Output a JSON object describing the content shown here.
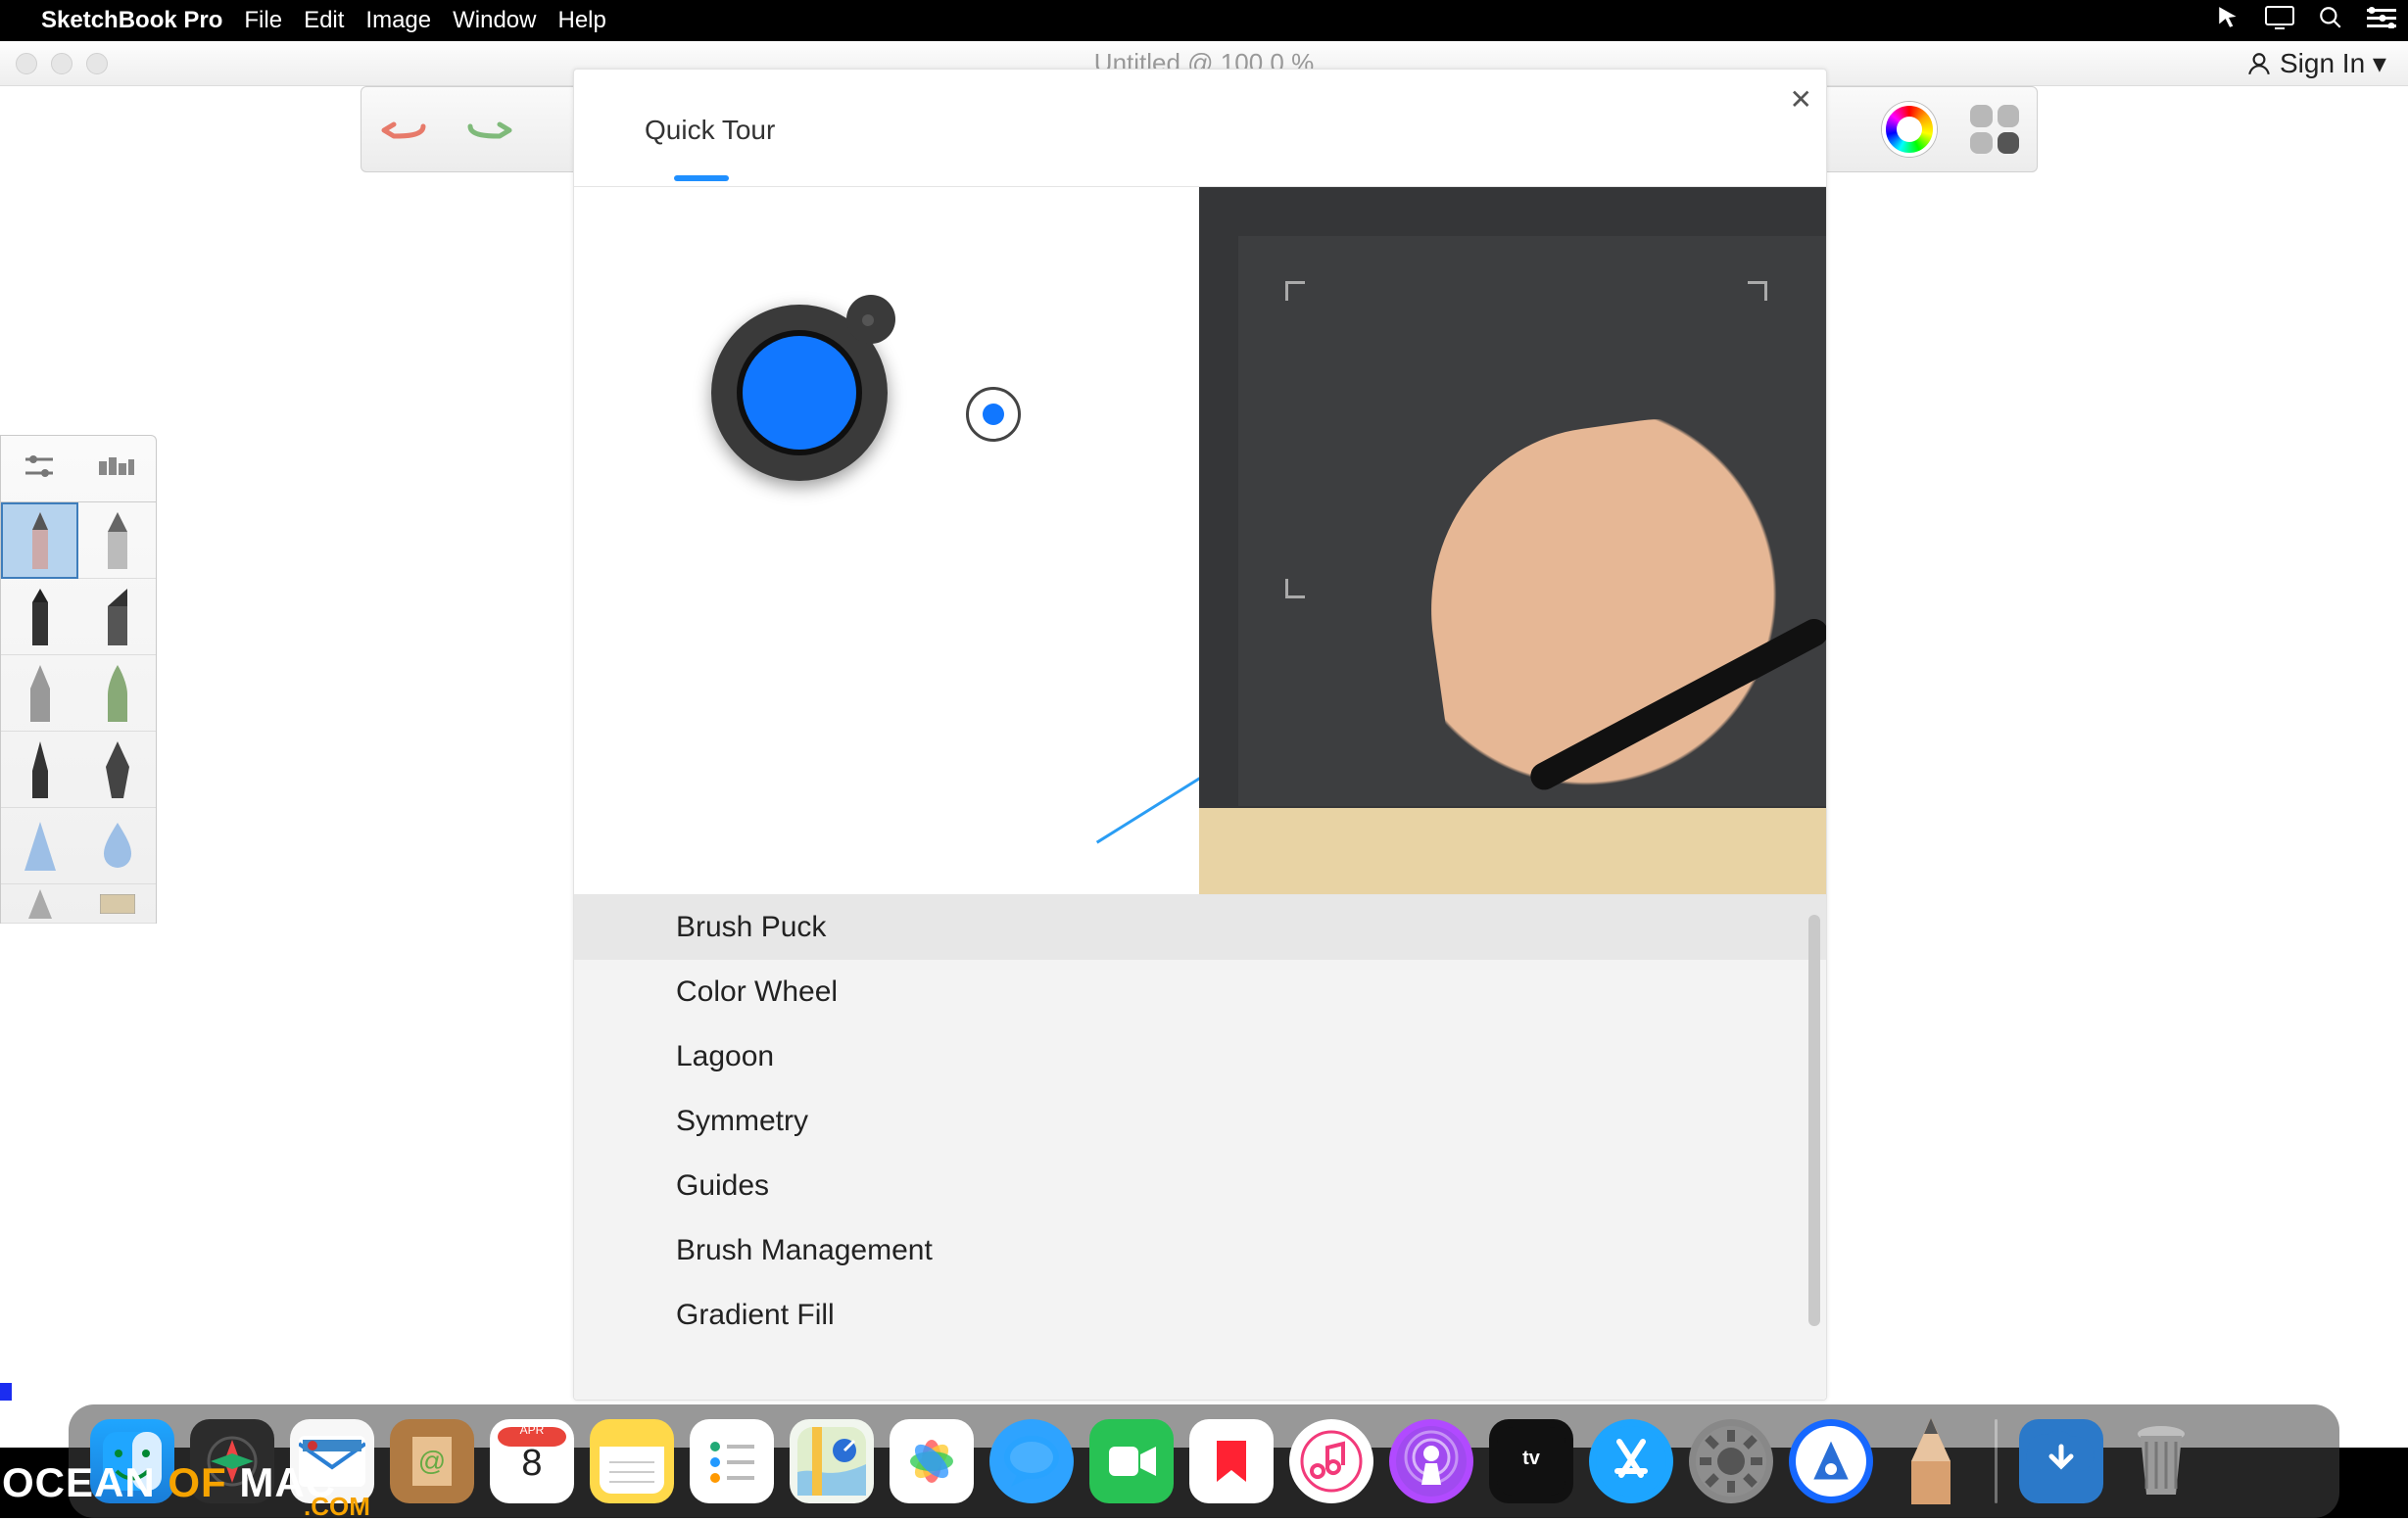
{
  "menubar": {
    "app_name": "SketchBook Pro",
    "items": [
      "File",
      "Edit",
      "Image",
      "Window",
      "Help"
    ]
  },
  "window": {
    "title": "Untitled @ 100.0 %",
    "signin_label": "Sign In ▾"
  },
  "toolbar": {
    "undo": "undo",
    "redo": "redo"
  },
  "brush_palette": {
    "brushes": [
      "pencil",
      "pen",
      "marker",
      "chisel",
      "nib",
      "brushpen",
      "ink",
      "fountain",
      "airbrush-soft",
      "airbrush-drop",
      "airbrush-tri",
      "flat"
    ]
  },
  "dialog": {
    "title": "Quick Tour",
    "topics": [
      "Brush Puck",
      "Color Wheel",
      "Lagoon",
      "Symmetry",
      "Guides",
      "Brush Management",
      "Gradient Fill"
    ],
    "selected_index": 0
  },
  "dock": {
    "apps": [
      "Finder",
      "Launchpad",
      "Mail",
      "Contacts",
      "Calendar",
      "Notes",
      "Reminders",
      "Maps",
      "Photos",
      "Messages",
      "FaceTime",
      "News",
      "Music",
      "Podcasts",
      "TV",
      "App Store",
      "System Preferences",
      "Preview",
      "SketchBook"
    ],
    "calendar_month": "APR",
    "calendar_day": "8",
    "right": [
      "Downloads",
      "Trash"
    ]
  },
  "watermark": {
    "t1": "OCEAN",
    "t2": "OF",
    "t3": "MAC",
    "t4": ".COM"
  }
}
